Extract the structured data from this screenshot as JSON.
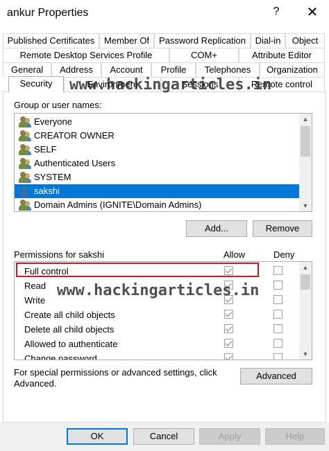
{
  "window": {
    "title": "ankur Properties",
    "help_glyph": "?",
    "close_glyph": "✕"
  },
  "tabs": {
    "row1": [
      "Published Certificates",
      "Member Of",
      "Password Replication",
      "Dial-in",
      "Object"
    ],
    "row2": [
      "Remote Desktop Services Profile",
      "COM+",
      "Attribute Editor"
    ],
    "row3": [
      "General",
      "Address",
      "Account",
      "Profile",
      "Telephones",
      "Organization"
    ],
    "row4": [
      "Security",
      "Environment",
      "Sessions",
      "Remote control"
    ],
    "active": "Security"
  },
  "groups": {
    "label": "Group or user names:",
    "items": [
      {
        "name": "Everyone",
        "icon": "group-icon"
      },
      {
        "name": "CREATOR OWNER",
        "icon": "group-icon"
      },
      {
        "name": "SELF",
        "icon": "group-icon"
      },
      {
        "name": "Authenticated Users",
        "icon": "group-icon"
      },
      {
        "name": "SYSTEM",
        "icon": "group-icon"
      },
      {
        "name": "sakshi",
        "icon": "user-icon",
        "selected": true
      },
      {
        "name": "Domain Admins (IGNITE\\Domain Admins)",
        "icon": "group-icon"
      }
    ],
    "add_label": "Add...",
    "remove_label": "Remove"
  },
  "permissions": {
    "label": "Permissions for sakshi",
    "allow_header": "Allow",
    "deny_header": "Deny",
    "rows": [
      {
        "name": "Full control",
        "allow": true,
        "deny": false,
        "highlighted": true
      },
      {
        "name": "Read",
        "allow": true,
        "deny": false
      },
      {
        "name": "Write",
        "allow": true,
        "deny": false
      },
      {
        "name": "Create all child objects",
        "allow": true,
        "deny": false
      },
      {
        "name": "Delete all child objects",
        "allow": true,
        "deny": false
      },
      {
        "name": "Allowed to authenticate",
        "allow": true,
        "deny": false
      },
      {
        "name": "Change password",
        "allow": true,
        "deny": false
      }
    ],
    "special_text_line1": "For special permissions or advanced settings, click",
    "special_text_line2": "Advanced.",
    "advanced_label": "Advanced"
  },
  "footer": {
    "ok_label": "OK",
    "cancel_label": "Cancel",
    "apply_label": "Apply",
    "help_label": "Help"
  },
  "watermark": "www.hackingarticles.in",
  "colors": {
    "selection": "#0078d7",
    "highlight_border": "#e0101e",
    "button_face": "#e1e1e1"
  }
}
